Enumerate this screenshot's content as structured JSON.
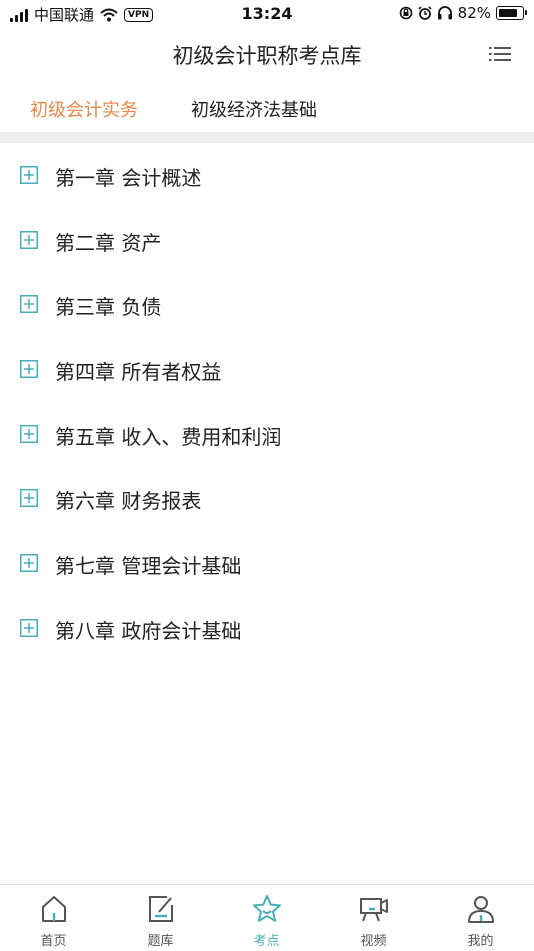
{
  "status_bar": {
    "carrier": "中国联通",
    "vpn": "VPN",
    "time": "13:24",
    "battery": "82%",
    "battery_level": 0.82
  },
  "header": {
    "title": "初级会计职称考点库",
    "menu_icon": "list-icon"
  },
  "tabs": [
    {
      "label": "初级会计实务",
      "active": true
    },
    {
      "label": "初级经济法基础",
      "active": false
    }
  ],
  "chapters": [
    {
      "label": "第一章 会计概述"
    },
    {
      "label": "第二章 资产"
    },
    {
      "label": "第三章 负债"
    },
    {
      "label": "第四章 所有者权益"
    },
    {
      "label": "第五章 收入、费用和利润"
    },
    {
      "label": "第六章 财务报表"
    },
    {
      "label": "第七章 管理会计基础"
    },
    {
      "label": "第八章 政府会计基础"
    }
  ],
  "bottom_tabs": [
    {
      "label": "首页",
      "icon": "home-icon",
      "active": false
    },
    {
      "label": "题库",
      "icon": "edit-icon",
      "active": false
    },
    {
      "label": "考点",
      "icon": "star-icon",
      "active": true
    },
    {
      "label": "视频",
      "icon": "video-camera-icon",
      "active": false
    },
    {
      "label": "我的",
      "icon": "user-icon",
      "active": false
    }
  ],
  "colors": {
    "accent_orange": "#e58a4a",
    "accent_teal": "#4aaeb8",
    "icon_gray": "#555555"
  }
}
